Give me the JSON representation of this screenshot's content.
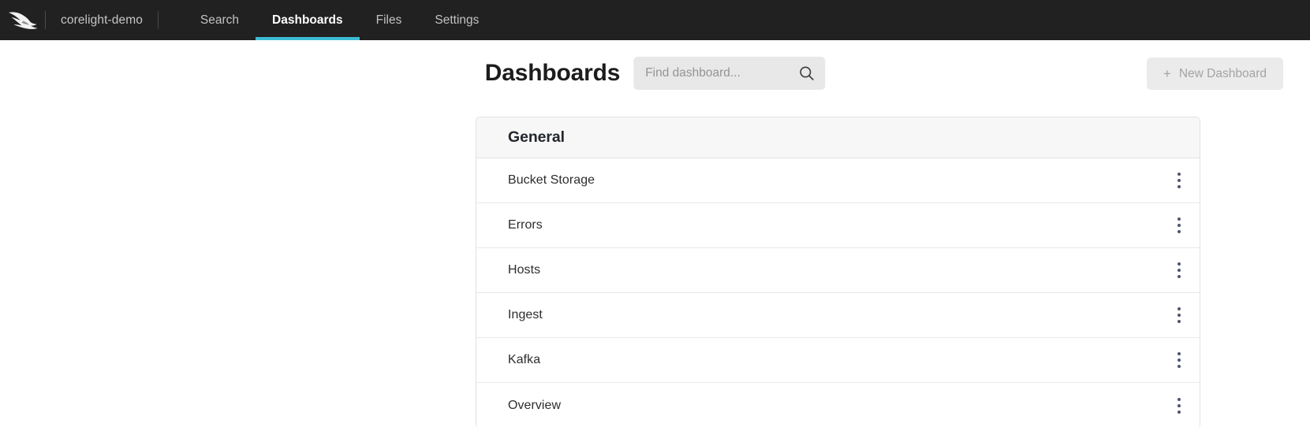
{
  "navbar": {
    "logo_name": "crowdstrike-falcon-logo",
    "tenant": "corelight-demo",
    "tabs": [
      {
        "label": "Search",
        "active": false
      },
      {
        "label": "Dashboards",
        "active": true
      },
      {
        "label": "Files",
        "active": false
      },
      {
        "label": "Settings",
        "active": false
      }
    ],
    "background_color": "#212121",
    "active_tab_underline_color": "#3cbcd5"
  },
  "header": {
    "title": "Dashboards",
    "search": {
      "placeholder": "Find dashboard...",
      "value": "",
      "icon": "search-icon"
    },
    "new_dashboard_button": {
      "label": "New Dashboard",
      "plus": "+",
      "disabled": true
    }
  },
  "dashboard_list": {
    "section_title": "General",
    "row_menu_icon": "kebab-menu-icon",
    "items": [
      {
        "label": "Bucket Storage"
      },
      {
        "label": "Errors"
      },
      {
        "label": "Hosts"
      },
      {
        "label": "Ingest"
      },
      {
        "label": "Kafka"
      },
      {
        "label": "Overview"
      }
    ]
  }
}
